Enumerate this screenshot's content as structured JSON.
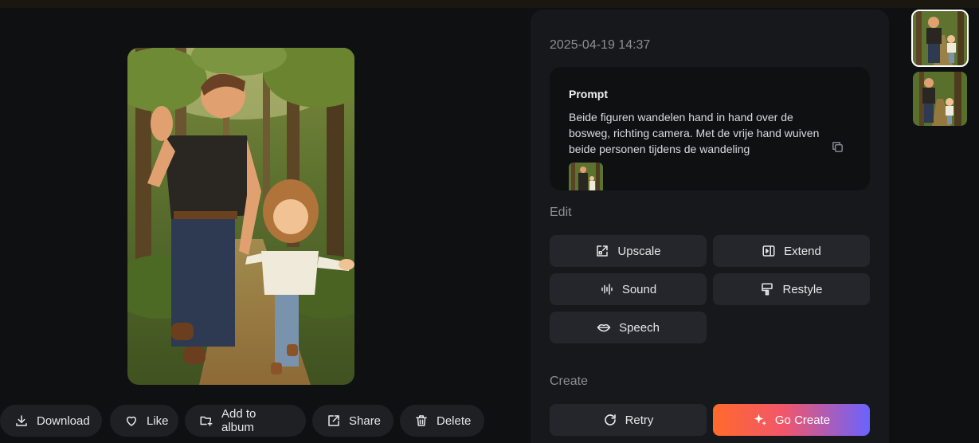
{
  "detail": {
    "timestamp": "2025-04-19 14:37",
    "prompt": {
      "title": "Prompt",
      "text": "Beide figuren wandelen hand in hand over de bosweg, richting camera. Met de vrije hand wuiven beide personen tijdens de wandeling"
    },
    "edit": {
      "label": "Edit",
      "buttons": [
        {
          "label": "Upscale",
          "icon": "upscale-icon"
        },
        {
          "label": "Extend",
          "icon": "extend-icon"
        },
        {
          "label": "Sound",
          "icon": "sound-wave-icon"
        },
        {
          "label": "Restyle",
          "icon": "paint-roller-icon"
        },
        {
          "label": "Speech",
          "icon": "lips-icon"
        }
      ]
    },
    "create": {
      "label": "Create",
      "buttons": [
        {
          "label": "Retry",
          "icon": "retry-icon"
        },
        {
          "label": "Go Create",
          "icon": "sparkle-icon"
        }
      ]
    }
  },
  "actions": [
    {
      "label": "Download",
      "icon": "download-icon"
    },
    {
      "label": "Like",
      "icon": "heart-icon"
    },
    {
      "label": "Add to album",
      "icon": "add-album-icon"
    },
    {
      "label": "Share",
      "icon": "share-icon"
    },
    {
      "label": "Delete",
      "icon": "trash-icon"
    }
  ],
  "colors": {
    "background": "#0f1012",
    "panel": "#17181b",
    "button": "#24262b",
    "go_create_gradient": [
      "#ff6a2b",
      "#f2566a",
      "#6a63ff"
    ]
  }
}
